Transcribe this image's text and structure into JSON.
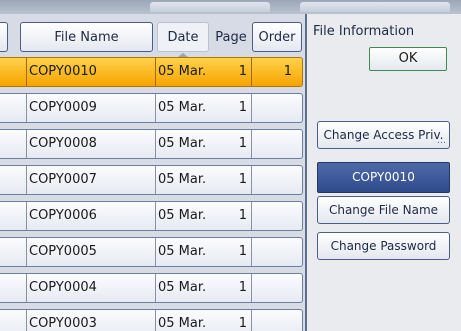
{
  "columns": {
    "file_name": "File Name",
    "date": "Date",
    "page": "Page",
    "order": "Order"
  },
  "rows": [
    {
      "name": "COPY0010",
      "date": "05 Mar.",
      "page": "1",
      "order": "1",
      "selected": true
    },
    {
      "name": "COPY0009",
      "date": "05 Mar.",
      "page": "1",
      "order": ""
    },
    {
      "name": "COPY0008",
      "date": "05 Mar.",
      "page": "1",
      "order": ""
    },
    {
      "name": "COPY0007",
      "date": "05 Mar.",
      "page": "1",
      "order": ""
    },
    {
      "name": "COPY0006",
      "date": "05 Mar.",
      "page": "1",
      "order": ""
    },
    {
      "name": "COPY0005",
      "date": "05 Mar.",
      "page": "1",
      "order": ""
    },
    {
      "name": "COPY0004",
      "date": "05 Mar.",
      "page": "1",
      "order": ""
    },
    {
      "name": "COPY0003",
      "date": "05 Mar.",
      "page": "1",
      "order": ""
    }
  ],
  "file_info": {
    "label": "File Information",
    "ok_label": "OK",
    "change_access_label": "Change Access Priv.",
    "selected_file": "COPY0010",
    "change_name_label": "Change File Name",
    "change_password_label": "Change Password"
  },
  "colors": {
    "selected_row": "#f6a400",
    "selected_file_display": "#304b8c",
    "ok_border": "#3f8a52"
  }
}
